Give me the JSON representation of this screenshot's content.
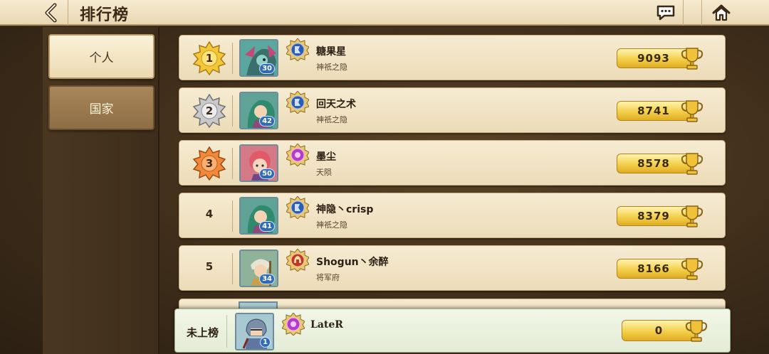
{
  "header": {
    "title": "排行榜",
    "back_icon": "chevron-left-icon",
    "chat_icon": "chat-bubble-icon",
    "home_icon": "home-icon"
  },
  "tabs": [
    {
      "label": "个人",
      "active": true
    },
    {
      "label": "国家",
      "active": false
    }
  ],
  "rows": [
    {
      "rank": "1",
      "badge": "gold",
      "level": "30",
      "name": "糖果星",
      "guild": "神祇之隐",
      "faction": "blue",
      "score": "9093",
      "avatar_color": "#5aa7a0"
    },
    {
      "rank": "2",
      "badge": "silver",
      "level": "42",
      "name": "回天之术",
      "guild": "神祇之隐",
      "faction": "blue",
      "score": "8741",
      "avatar_color": "#5fa396"
    },
    {
      "rank": "3",
      "badge": "bronze",
      "level": "50",
      "name": "墨尘",
      "guild": "天陨",
      "faction": "purple",
      "score": "8578",
      "avatar_color": "#d47a86"
    },
    {
      "rank": "4",
      "badge": "none",
      "level": "41",
      "name": "神隐丶crisp",
      "guild": "神祇之隐",
      "faction": "blue",
      "score": "8379",
      "avatar_color": "#5fa396"
    },
    {
      "rank": "5",
      "badge": "none",
      "level": "34",
      "name": "Shogun丶余醉",
      "guild": "将军府",
      "faction": "red",
      "score": "8166",
      "avatar_color": "#8fb39a"
    }
  ],
  "self": {
    "label": "未上榜",
    "level": "1",
    "name": "LateR",
    "faction": "purple",
    "score": "0"
  },
  "colors": {
    "gold": "#f2c73a",
    "silver": "#c9c9c9",
    "bronze": "#f08a3a",
    "blue_faction": "#2d5bb5",
    "purple_faction": "#b43cc8",
    "red_faction": "#c03a22"
  }
}
